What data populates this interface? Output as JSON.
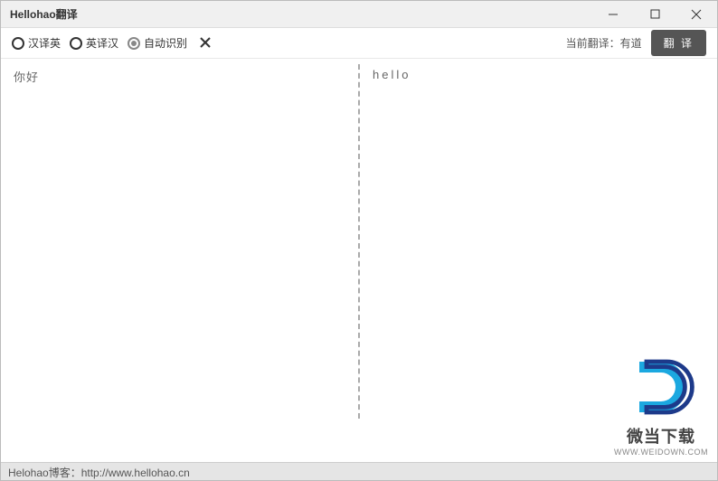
{
  "window": {
    "title": "Hellohao翻译"
  },
  "toolbar": {
    "radios": [
      {
        "label": "汉译英",
        "selected": false
      },
      {
        "label": "英译汉",
        "selected": false
      },
      {
        "label": "自动识别",
        "selected": true
      }
    ],
    "engine_label": "当前翻译：有道",
    "translate_button": "翻 译"
  },
  "content": {
    "source_text": "你好",
    "target_text": "hello"
  },
  "watermark": {
    "title": "微当下载",
    "url": "WWW.WEIDOWN.COM"
  },
  "statusbar": {
    "text": "Helohao博客：http://www.hellohao.cn"
  }
}
